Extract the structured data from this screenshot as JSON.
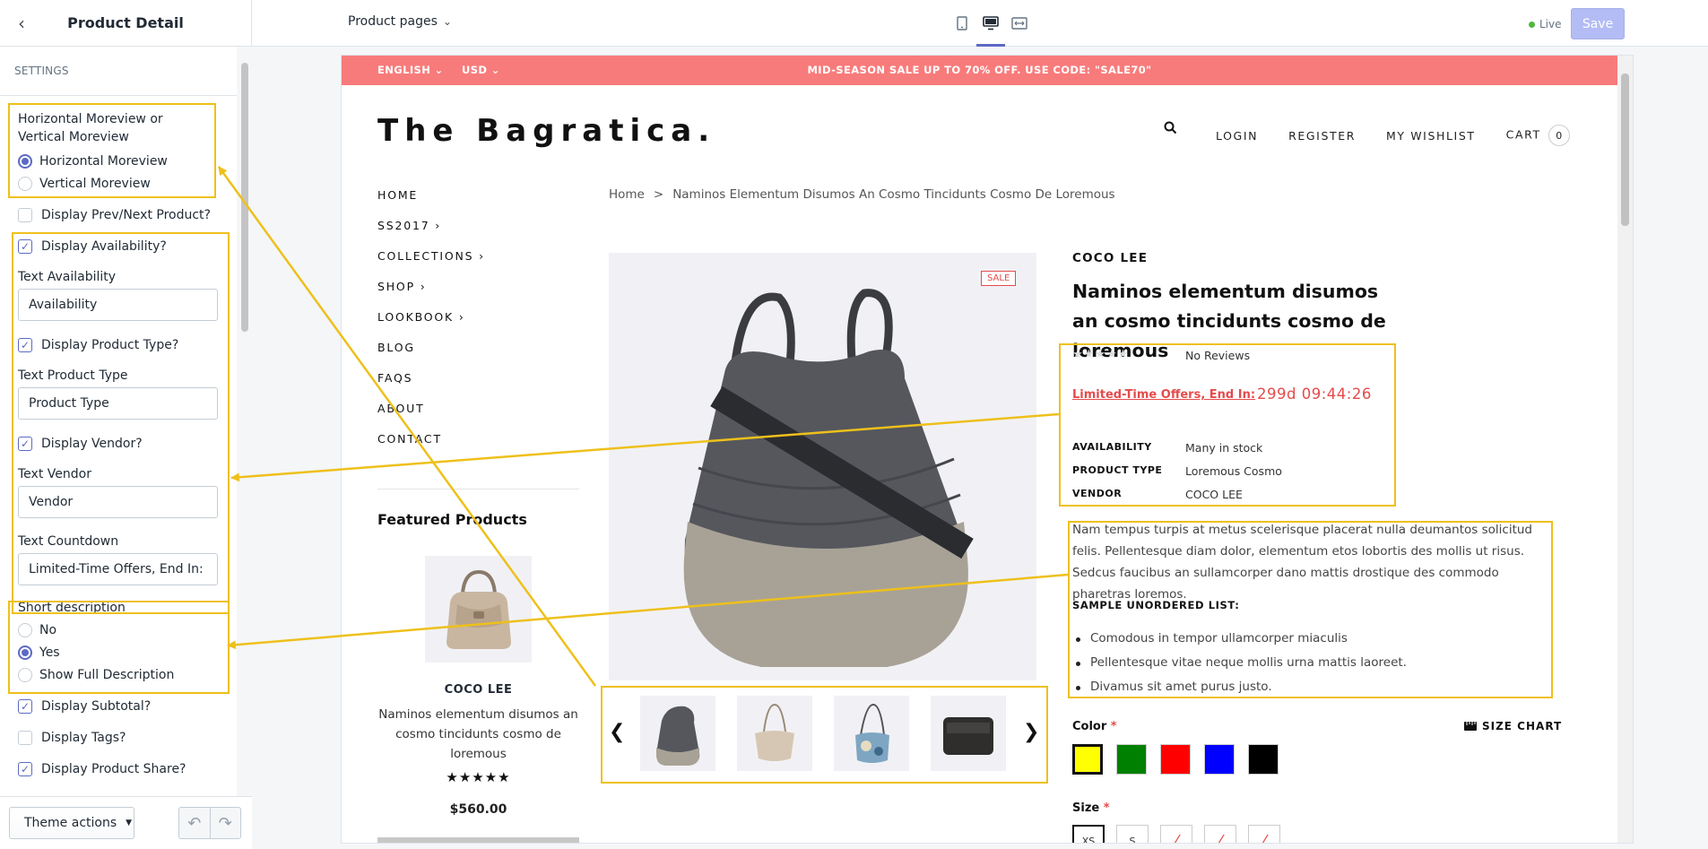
{
  "sidebar": {
    "title": "Product Detail",
    "section": "SETTINGS",
    "moreview_label": "Horizontal Moreview or Vertical Moreview",
    "moreview_options": [
      "Horizontal Moreview",
      "Vertical Moreview"
    ],
    "moreview_selected": "Horizontal Moreview",
    "prevnext_label": "Display Prev/Next Product?",
    "availability_label": "Display Availability?",
    "text_availability_label": "Text Availability",
    "text_availability_value": "Availability",
    "product_type_label": "Display Product Type?",
    "text_product_type_label": "Text Product Type",
    "text_product_type_value": "Product Type",
    "vendor_label": "Display Vendor?",
    "text_vendor_label": "Text Vendor",
    "text_vendor_value": "Vendor",
    "text_countdown_label": "Text Countdown",
    "text_countdown_value": "Limited-Time Offers, End In:",
    "short_desc_label": "Short description",
    "short_desc_options": [
      "No",
      "Yes",
      "Show Full Description"
    ],
    "short_desc_selected": "Yes",
    "subtotal_label": "Display Subtotal?",
    "tags_label": "Display Tags?",
    "share_label": "Display Product Share?",
    "theme_actions": "Theme actions"
  },
  "topbar": {
    "page_select": "Product pages",
    "live": "Live",
    "save": "Save"
  },
  "store": {
    "language": "ENGLISH",
    "currency": "USD",
    "announcement": "MID-SEASON SALE UP TO 70% OFF. USE CODE: \"SALE70\"",
    "logo": "The Bagratica.",
    "user_nav": [
      "LOGIN",
      "REGISTER",
      "MY WISHLIST",
      "CART"
    ],
    "cart_count": "0",
    "main_nav": [
      "HOME",
      "SS2017",
      "COLLECTIONS",
      "SHOP",
      "LOOKBOOK",
      "BLOG",
      "FAQS",
      "ABOUT",
      "CONTACT"
    ],
    "featured": {
      "title": "Featured Products",
      "brand": "COCO LEE",
      "name": "Naminos elementum disumos an cosmo tincidunts cosmo de loremous",
      "stars": "★★★★★",
      "price": "$560.00"
    },
    "breadcrumb": {
      "home": "Home",
      "sep": ">",
      "current": "Naminos Elementum Disumos An Cosmo Tincidunts Cosmo De Loremous"
    },
    "sale_badge": "SALE",
    "product": {
      "brand": "COCO LEE",
      "title": "Naminos elementum disumos an cosmo tincidunts cosmo de loremous",
      "stars": "★★★★★",
      "reviews": "No Reviews",
      "offer_text": "Limited-Time Offers, End In:",
      "timer": "299d 09:44:26",
      "availability_key": "AVAILABILITY",
      "availability_val": "Many in stock",
      "type_key": "PRODUCT TYPE",
      "type_val": "Loremous Cosmo",
      "vendor_key": "VENDOR",
      "vendor_val": "COCO LEE",
      "description": "Nam tempus turpis at metus scelerisque placerat nulla deumantos solicitud felis. Pellentesque diam dolor, elementum etos lobortis des mollis ut risus. Sedcus faucibus an sullamcorper dano mattis drostique des commodo pharetras loremos.",
      "list_title": "SAMPLE UNORDERED LIST:",
      "list": [
        "Comodous in tempor ullamcorper miaculis",
        "Pellentesque vitae neque mollis urna mattis laoreet.",
        "Divamus sit amet purus justo."
      ],
      "color_label": "Color",
      "size_chart": "SIZE CHART",
      "colors": [
        "#ffff00",
        "#008000",
        "#ff0000",
        "#0000ff",
        "#000000"
      ],
      "size_label": "Size",
      "sizes": [
        "XS",
        "S"
      ]
    }
  }
}
